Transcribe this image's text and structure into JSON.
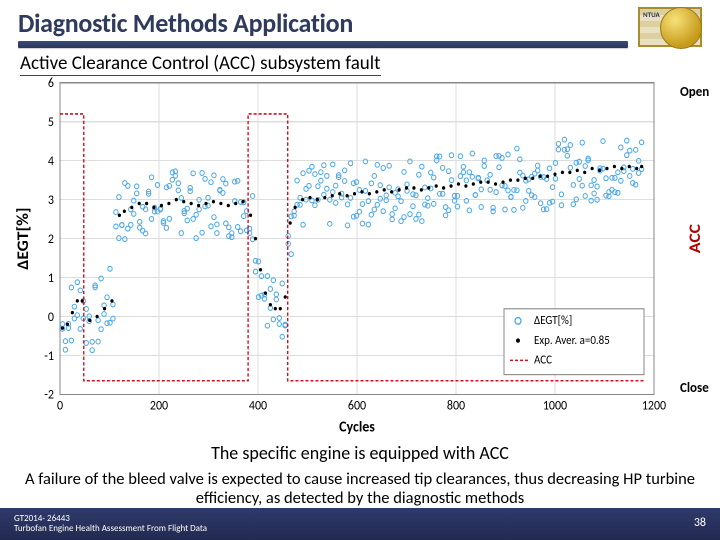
{
  "header": {
    "title": "Diagnostic Methods Application",
    "logo_text": "NTUA"
  },
  "subtitle": "Active Clearance Control (ACC) subsystem fault",
  "chart_data": {
    "type": "scatter",
    "xlabel": "Cycles",
    "ylabel": "ΔEGT[%]",
    "secondary_ylabel": "ACC",
    "xlim": [
      0,
      1200
    ],
    "ylim": [
      -2,
      6
    ],
    "xticks": [
      0,
      200,
      400,
      600,
      800,
      1000,
      1200
    ],
    "yticks": [
      -2,
      -1,
      0,
      1,
      2,
      3,
      4,
      5,
      6
    ],
    "side_labels": {
      "open": "Open",
      "close": "Close"
    },
    "series": [
      {
        "name": "ΔEGT[%]",
        "kind": "scatter",
        "color": "#4ca8e8"
      },
      {
        "name": "Exp. Aver. a=0.85",
        "kind": "trend",
        "color": "#000000"
      },
      {
        "name": "ACC",
        "kind": "step",
        "color": "#d01020"
      }
    ],
    "acc_segments": [
      {
        "x0": 0,
        "x1": 48,
        "y": 5.2
      },
      {
        "x0": 48,
        "x1": 380,
        "y": -1.65
      },
      {
        "x0": 380,
        "x1": 460,
        "y": 5.2
      },
      {
        "x0": 460,
        "x1": 1180,
        "y": -1.65
      }
    ],
    "trend_points": [
      [
        5,
        -0.3
      ],
      [
        15,
        -0.2
      ],
      [
        25,
        0.1
      ],
      [
        35,
        0.4
      ],
      [
        45,
        0.4
      ],
      [
        60,
        -0.1
      ],
      [
        75,
        0.0
      ],
      [
        90,
        0.2
      ],
      [
        105,
        0.4
      ],
      [
        120,
        2.6
      ],
      [
        130,
        2.7
      ],
      [
        145,
        2.8
      ],
      [
        160,
        2.9
      ],
      [
        175,
        2.9
      ],
      [
        190,
        2.8
      ],
      [
        205,
        2.85
      ],
      [
        220,
        2.9
      ],
      [
        235,
        3.0
      ],
      [
        250,
        2.95
      ],
      [
        265,
        2.9
      ],
      [
        280,
        2.85
      ],
      [
        295,
        2.9
      ],
      [
        310,
        2.95
      ],
      [
        325,
        2.9
      ],
      [
        340,
        2.85
      ],
      [
        355,
        2.9
      ],
      [
        370,
        2.95
      ],
      [
        385,
        2.6
      ],
      [
        395,
        2.0
      ],
      [
        405,
        1.2
      ],
      [
        415,
        0.6
      ],
      [
        425,
        0.3
      ],
      [
        435,
        0.2
      ],
      [
        445,
        0.2
      ],
      [
        455,
        0.5
      ],
      [
        465,
        2.4
      ],
      [
        475,
        2.8
      ],
      [
        490,
        3.0
      ],
      [
        505,
        3.05
      ],
      [
        520,
        3.0
      ],
      [
        535,
        3.05
      ],
      [
        550,
        3.1
      ],
      [
        565,
        3.15
      ],
      [
        580,
        3.1
      ],
      [
        595,
        3.15
      ],
      [
        610,
        3.2
      ],
      [
        625,
        3.15
      ],
      [
        640,
        3.2
      ],
      [
        655,
        3.25
      ],
      [
        670,
        3.2
      ],
      [
        685,
        3.25
      ],
      [
        700,
        3.3
      ],
      [
        715,
        3.3
      ],
      [
        730,
        3.25
      ],
      [
        745,
        3.3
      ],
      [
        760,
        3.35
      ],
      [
        775,
        3.3
      ],
      [
        790,
        3.35
      ],
      [
        805,
        3.4
      ],
      [
        820,
        3.35
      ],
      [
        835,
        3.4
      ],
      [
        850,
        3.45
      ],
      [
        865,
        3.45
      ],
      [
        880,
        3.4
      ],
      [
        895,
        3.45
      ],
      [
        910,
        3.5
      ],
      [
        925,
        3.5
      ],
      [
        940,
        3.55
      ],
      [
        955,
        3.55
      ],
      [
        970,
        3.6
      ],
      [
        985,
        3.6
      ],
      [
        1000,
        3.65
      ],
      [
        1015,
        3.7
      ],
      [
        1030,
        3.7
      ],
      [
        1045,
        3.75
      ],
      [
        1060,
        3.7
      ],
      [
        1075,
        3.8
      ],
      [
        1090,
        3.75
      ],
      [
        1105,
        3.8
      ],
      [
        1120,
        3.85
      ],
      [
        1135,
        3.8
      ],
      [
        1150,
        3.85
      ],
      [
        1165,
        3.8
      ],
      [
        1175,
        3.85
      ]
    ]
  },
  "body_text_1": "The specific engine is equipped with ACC",
  "body_text_2": "A failure of the bleed valve is expected to cause increased tip clearances, thus decreasing HP turbine efficiency, as detected by the diagnostic methods",
  "footer": {
    "line1": "GT2014- 26443",
    "line2": "Turbofan Engine Health Assessment From Flight Data",
    "page": "38"
  }
}
